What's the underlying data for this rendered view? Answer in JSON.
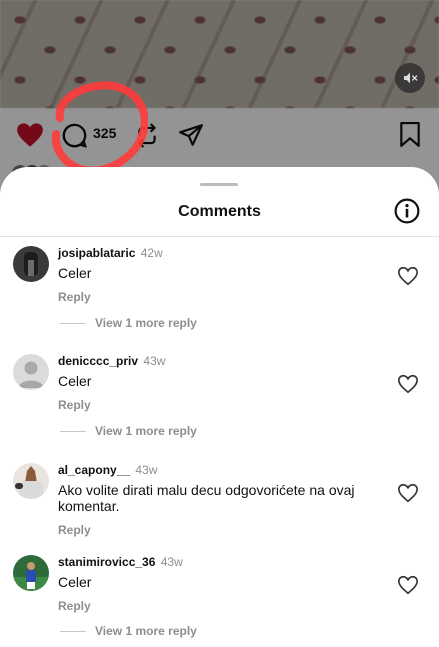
{
  "post": {
    "comment_count": "325"
  },
  "sheet": {
    "title": "Comments"
  },
  "comments": [
    {
      "username": "josipablataric",
      "time": "42w",
      "text": "Celer",
      "reply_label": "Reply",
      "view_more": "View 1 more reply"
    },
    {
      "username": "denicccc_priv",
      "time": "43w",
      "text": "Celer",
      "reply_label": "Reply",
      "view_more": "View 1 more reply"
    },
    {
      "username": "al_capony__",
      "time": "43w",
      "text": "Ako volite dirati malu decu odgovorićete na ovaj komentar.",
      "reply_label": "Reply"
    },
    {
      "username": "stanimirovicc_36",
      "time": "43w",
      "text": "Celer",
      "reply_label": "Reply",
      "view_more": "View 1 more reply"
    }
  ],
  "icons": {
    "like": "heart-filled-icon",
    "comment": "comment-icon",
    "repost": "repost-icon",
    "share": "send-icon",
    "save": "bookmark-icon",
    "mute": "speaker-muted-icon",
    "info": "info-icon",
    "comment_like": "heart-outline-icon"
  },
  "colors": {
    "like_red": "#c8102e",
    "annotation_red": "#ff3b3b",
    "muted_text": "#8e8e8e"
  }
}
